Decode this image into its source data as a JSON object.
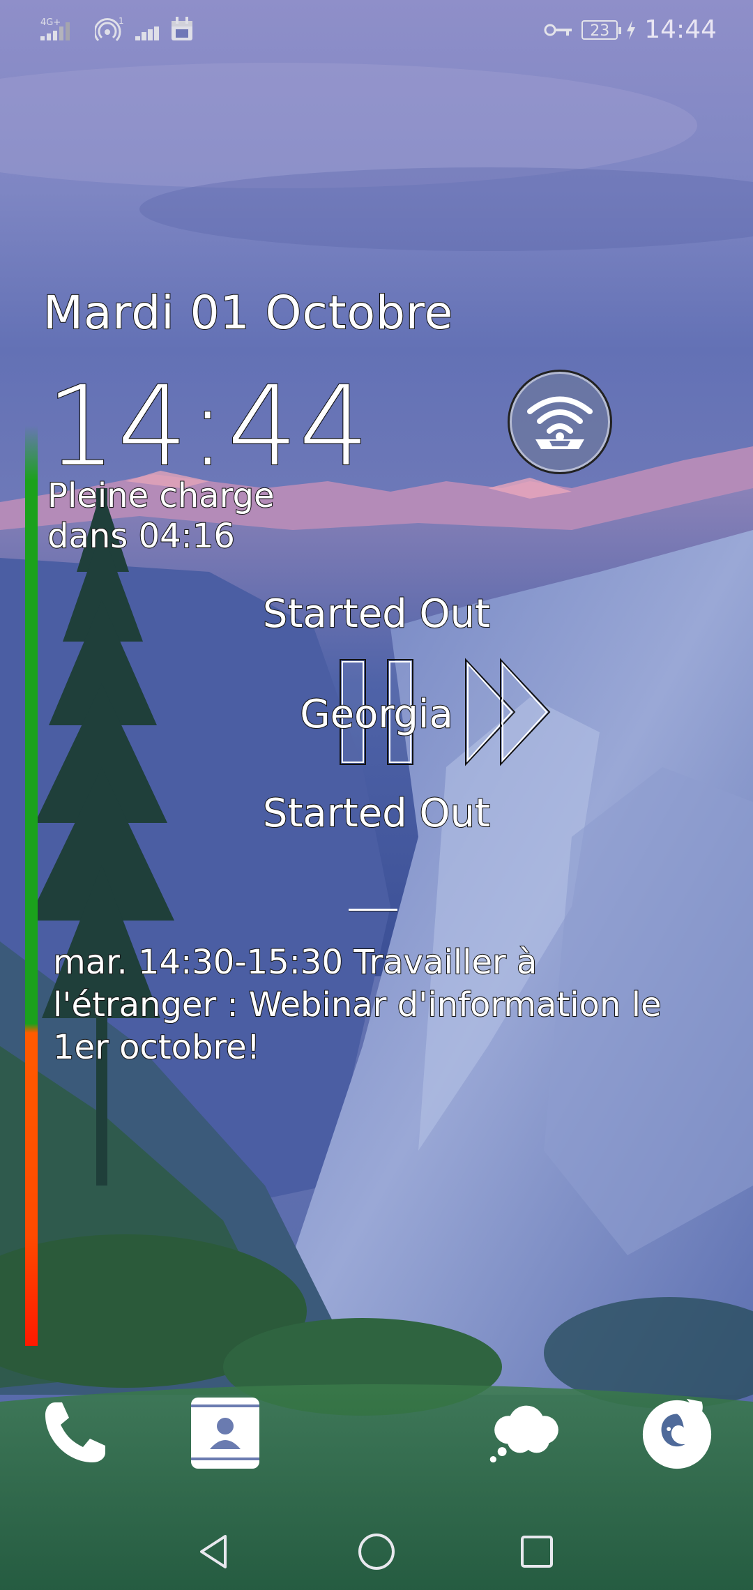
{
  "status_bar": {
    "network_label": "4G+",
    "hotspot_count": "1",
    "battery_level": "23",
    "time": "14:44"
  },
  "lock": {
    "date": "Mardi 01 Octobre",
    "clock": "14:44",
    "charge_line1": "Pleine charge",
    "charge_line2": "dans 04:16",
    "wifi_icon": "wifi-hotspot-icon"
  },
  "media": {
    "title_top": "Started Out",
    "artist": "Georgia",
    "title_bottom": "Started Out",
    "pause_icon": "pause-icon",
    "next_icon": "fast-forward-icon"
  },
  "calendar": {
    "event_text": "mar. 14:30-15:30 Travailler à l'étranger : Webinar d'information le 1er octobre!"
  },
  "battery_bar": {
    "charge_fraction": 0.23,
    "colors": [
      "#1ba11c",
      "#ff5a00",
      "#ff1a00"
    ]
  },
  "dock": {
    "apps": [
      "phone-icon",
      "contacts-icon",
      "messaging-icon",
      "firefox-icon"
    ]
  },
  "navigation": {
    "buttons": [
      "back-icon",
      "home-icon",
      "recents-icon"
    ]
  }
}
